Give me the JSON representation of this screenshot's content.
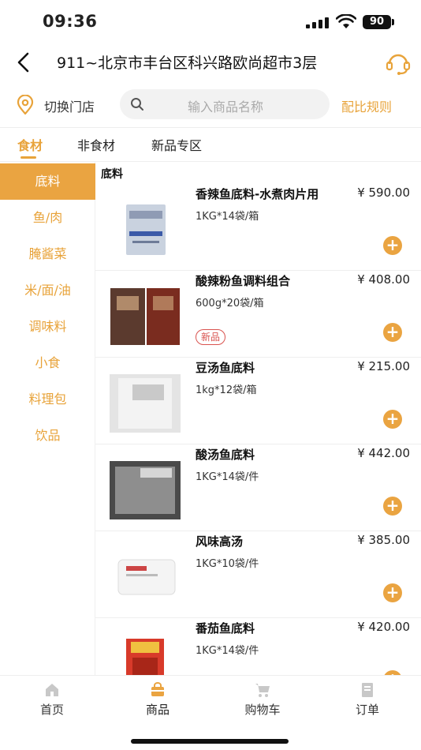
{
  "status": {
    "time": "09:36",
    "battery": "90"
  },
  "nav": {
    "title": "911~北京市丰台区科兴路欧尚超市3层"
  },
  "search": {
    "switch_store": "切换门店",
    "placeholder": "输入商品名称",
    "rules": "配比规则"
  },
  "tabs": [
    {
      "label": "食材",
      "active": true
    },
    {
      "label": "非食材"
    },
    {
      "label": "新品专区"
    }
  ],
  "categories": [
    {
      "label": "底料",
      "active": true
    },
    {
      "label": "鱼/肉"
    },
    {
      "label": "腌酱菜"
    },
    {
      "label": "米/面/油"
    },
    {
      "label": "调味料"
    },
    {
      "label": "小食"
    },
    {
      "label": "料理包"
    },
    {
      "label": "饮品"
    }
  ],
  "section_title": "底料",
  "products": [
    {
      "name": "香辣鱼底料-水煮肉片用",
      "price": "¥ 590.00",
      "spec": "1KG*14袋/箱",
      "tag": ""
    },
    {
      "name": "酸辣粉鱼调料组合",
      "price": "¥ 408.00",
      "spec": "600g*20袋/箱",
      "tag": "新品"
    },
    {
      "name": "豆汤鱼底料",
      "price": "¥ 215.00",
      "spec": "1kg*12袋/箱",
      "tag": ""
    },
    {
      "name": "酸汤鱼底料",
      "price": "¥ 442.00",
      "spec": "1KG*14袋/件",
      "tag": ""
    },
    {
      "name": "风味高汤",
      "price": "¥ 385.00",
      "spec": "1KG*10袋/件",
      "tag": ""
    },
    {
      "name": "番茄鱼底料",
      "price": "¥ 420.00",
      "spec": "1KG*14袋/件",
      "tag": ""
    }
  ],
  "tabbar": [
    {
      "label": "首页",
      "icon": "home-icon"
    },
    {
      "label": "商品",
      "icon": "shop-bag-icon",
      "active": true
    },
    {
      "label": "购物车",
      "icon": "cart-icon"
    },
    {
      "label": "订单",
      "icon": "order-icon"
    }
  ],
  "colors": {
    "accent": "#eaa441",
    "tag": "#d9534f"
  }
}
